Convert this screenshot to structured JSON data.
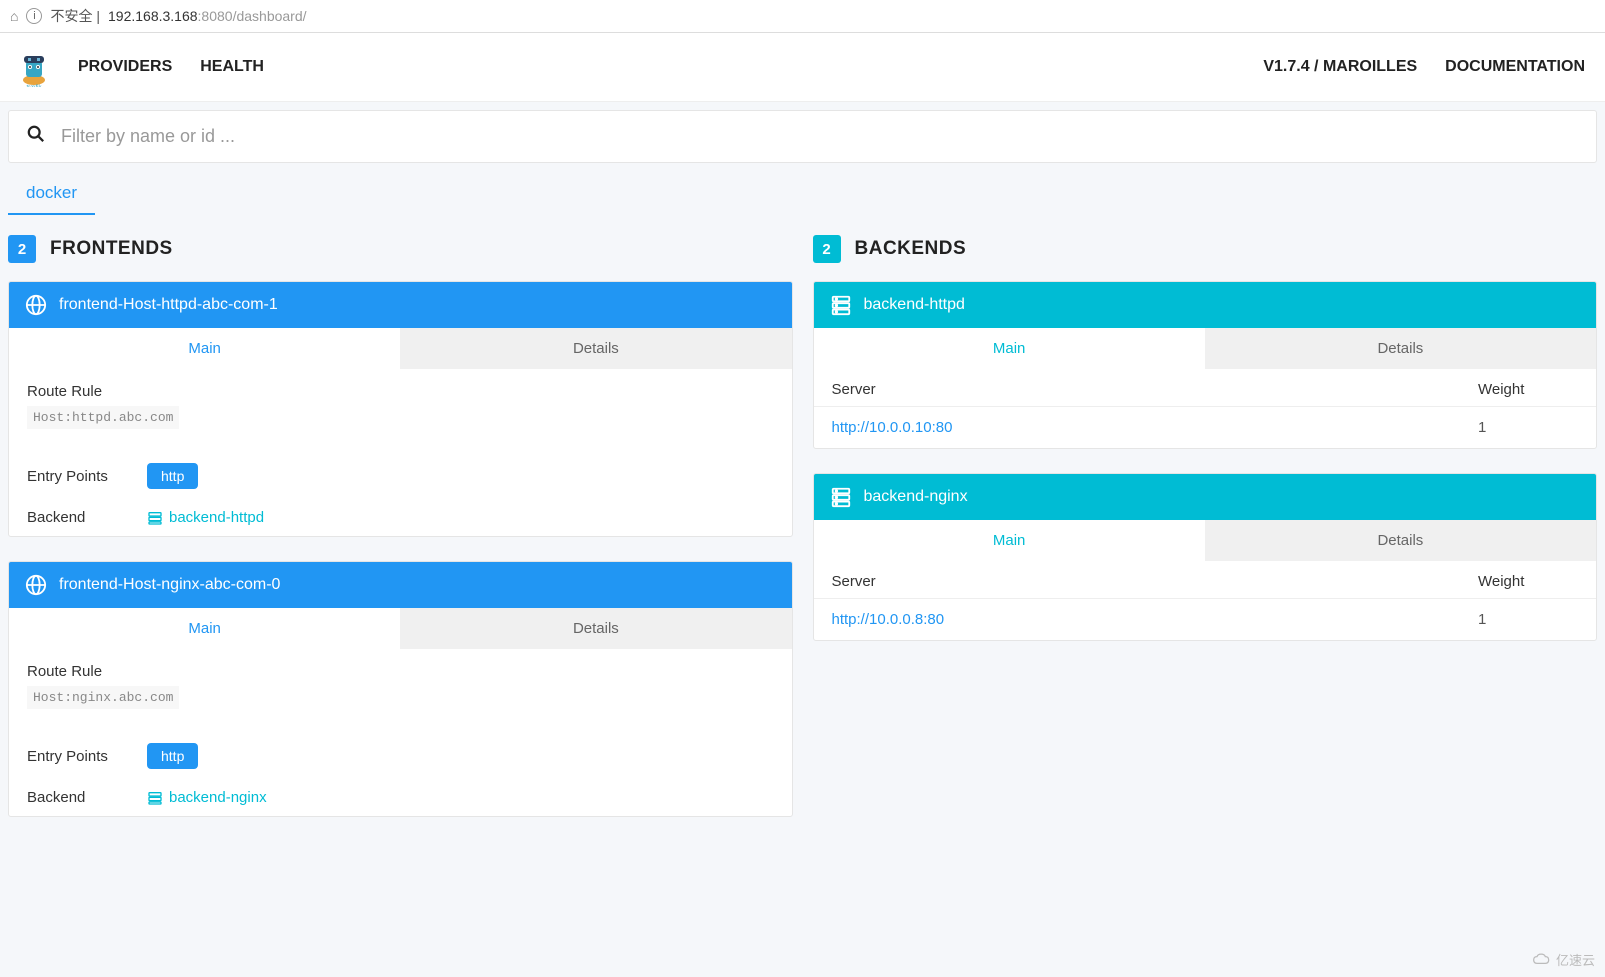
{
  "browser": {
    "insecure_label": "不安全",
    "url_host": "192.168.3.168",
    "url_port": ":8080",
    "url_path": "/dashboard/"
  },
  "nav": {
    "providers": "PROVIDERS",
    "health": "HEALTH",
    "version": "V1.7.4 / MAROILLES",
    "documentation": "DOCUMENTATION"
  },
  "search": {
    "placeholder": "Filter by name or id ..."
  },
  "provider_tab": "docker",
  "frontends": {
    "count": "2",
    "title": "FRONTENDS",
    "items": [
      {
        "name": "frontend-Host-httpd-abc-com-1",
        "tabs": {
          "main": "Main",
          "details": "Details"
        },
        "route_rule_label": "Route Rule",
        "route_rule_value": "Host:httpd.abc.com",
        "entry_points_label": "Entry Points",
        "entry_points_value": "http",
        "backend_label": "Backend",
        "backend_value": "backend-httpd"
      },
      {
        "name": "frontend-Host-nginx-abc-com-0",
        "tabs": {
          "main": "Main",
          "details": "Details"
        },
        "route_rule_label": "Route Rule",
        "route_rule_value": "Host:nginx.abc.com",
        "entry_points_label": "Entry Points",
        "entry_points_value": "http",
        "backend_label": "Backend",
        "backend_value": "backend-nginx"
      }
    ]
  },
  "backends": {
    "count": "2",
    "title": "BACKENDS",
    "items": [
      {
        "name": "backend-httpd",
        "tabs": {
          "main": "Main",
          "details": "Details"
        },
        "server_label": "Server",
        "weight_label": "Weight",
        "server_url": "http://10.0.0.10:80",
        "weight_value": "1"
      },
      {
        "name": "backend-nginx",
        "tabs": {
          "main": "Main",
          "details": "Details"
        },
        "server_label": "Server",
        "weight_label": "Weight",
        "server_url": "http://10.0.0.8:80",
        "weight_value": "1"
      }
    ]
  },
  "watermark": "亿速云"
}
